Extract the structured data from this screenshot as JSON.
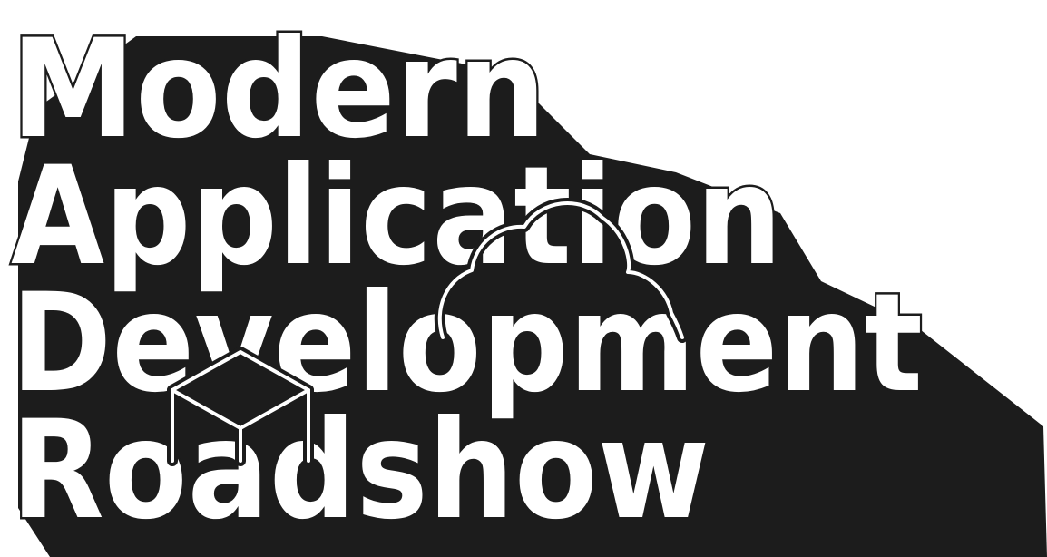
{
  "title_lines": [
    "Modern",
    "Application",
    "Development",
    "Roadshow"
  ],
  "colors": {
    "background": "#ffffff",
    "shadow": "#1c1c1c",
    "text_fill": "#ffffff",
    "text_outline": "#1c1c1c",
    "icon_stroke": "#ffffff"
  },
  "icons": [
    "cloud-icon",
    "cube-icon"
  ]
}
